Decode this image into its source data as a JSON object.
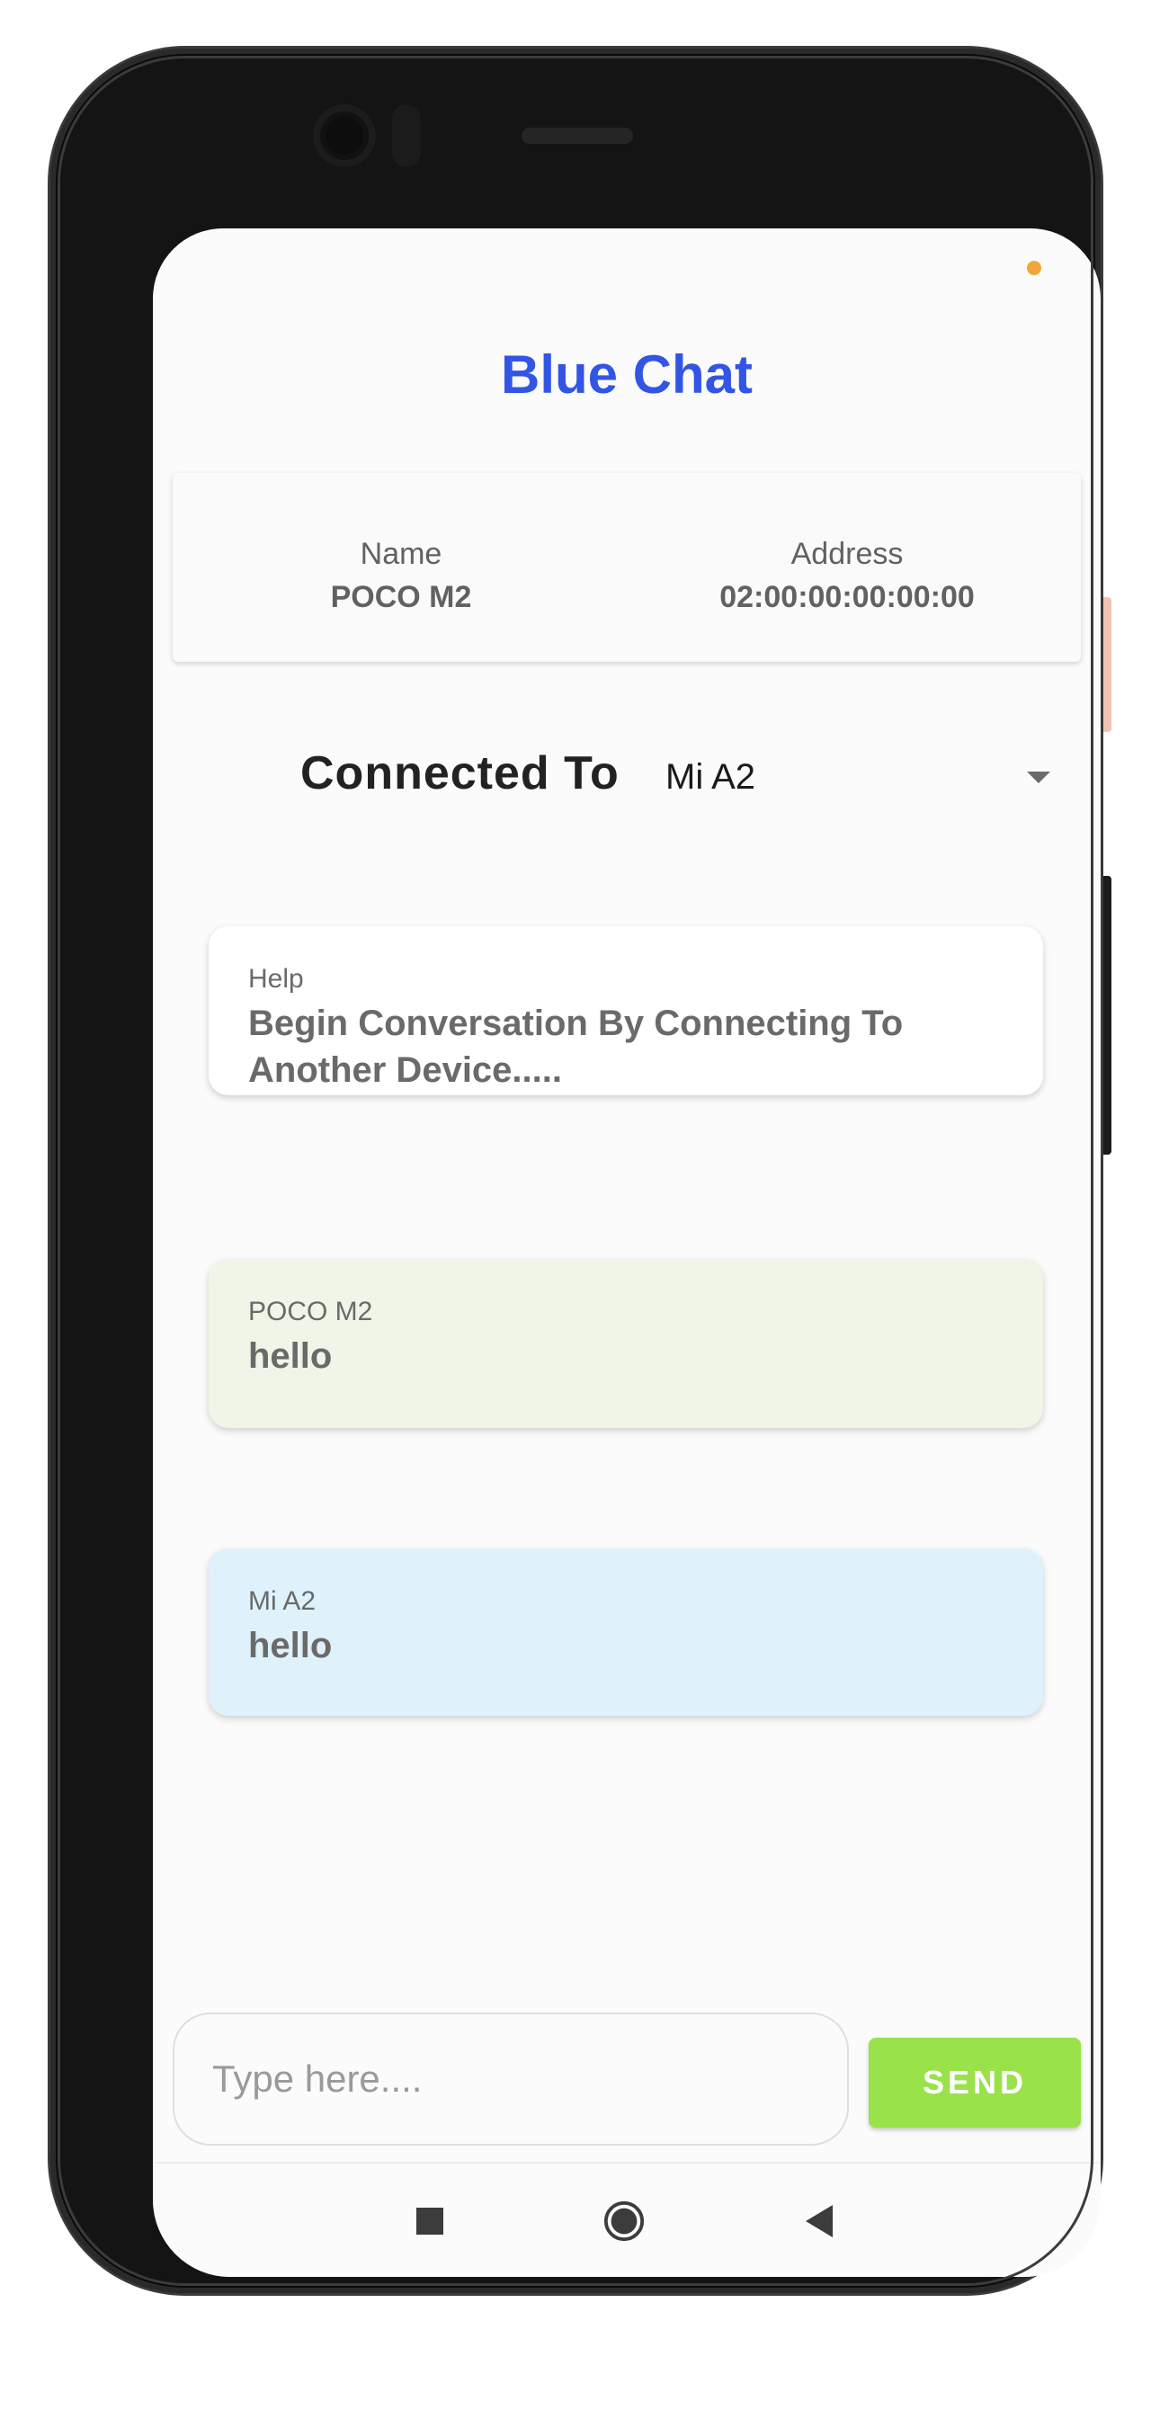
{
  "app": {
    "title": "Blue Chat"
  },
  "device_info": {
    "name_label": "Name",
    "name_value": "POCO M2",
    "address_label": "Address",
    "address_value": "02:00:00:00:00:00"
  },
  "connection": {
    "label": "Connected To",
    "selected_device": "Mi A2"
  },
  "messages": [
    {
      "sender": "Help",
      "text": "Begin Conversation By Connecting To Another Device.....",
      "style": "system",
      "color": "#ffffff"
    },
    {
      "sender": "POCO M2",
      "text": "hello",
      "style": "outgoing",
      "color": "#eff5e7"
    },
    {
      "sender": "Mi A2",
      "text": "hello",
      "style": "incoming",
      "color": "#dff2fc"
    }
  ],
  "composer": {
    "placeholder": "Type here....",
    "value": "",
    "send_label": "SEND"
  },
  "navigation": {
    "recents_icon": "square-icon",
    "home_icon": "circle-home-icon",
    "back_icon": "triangle-back-icon"
  },
  "colors": {
    "title": "#3355e6",
    "send_button": "#99e24a",
    "status_dot": "#f2a63a"
  }
}
